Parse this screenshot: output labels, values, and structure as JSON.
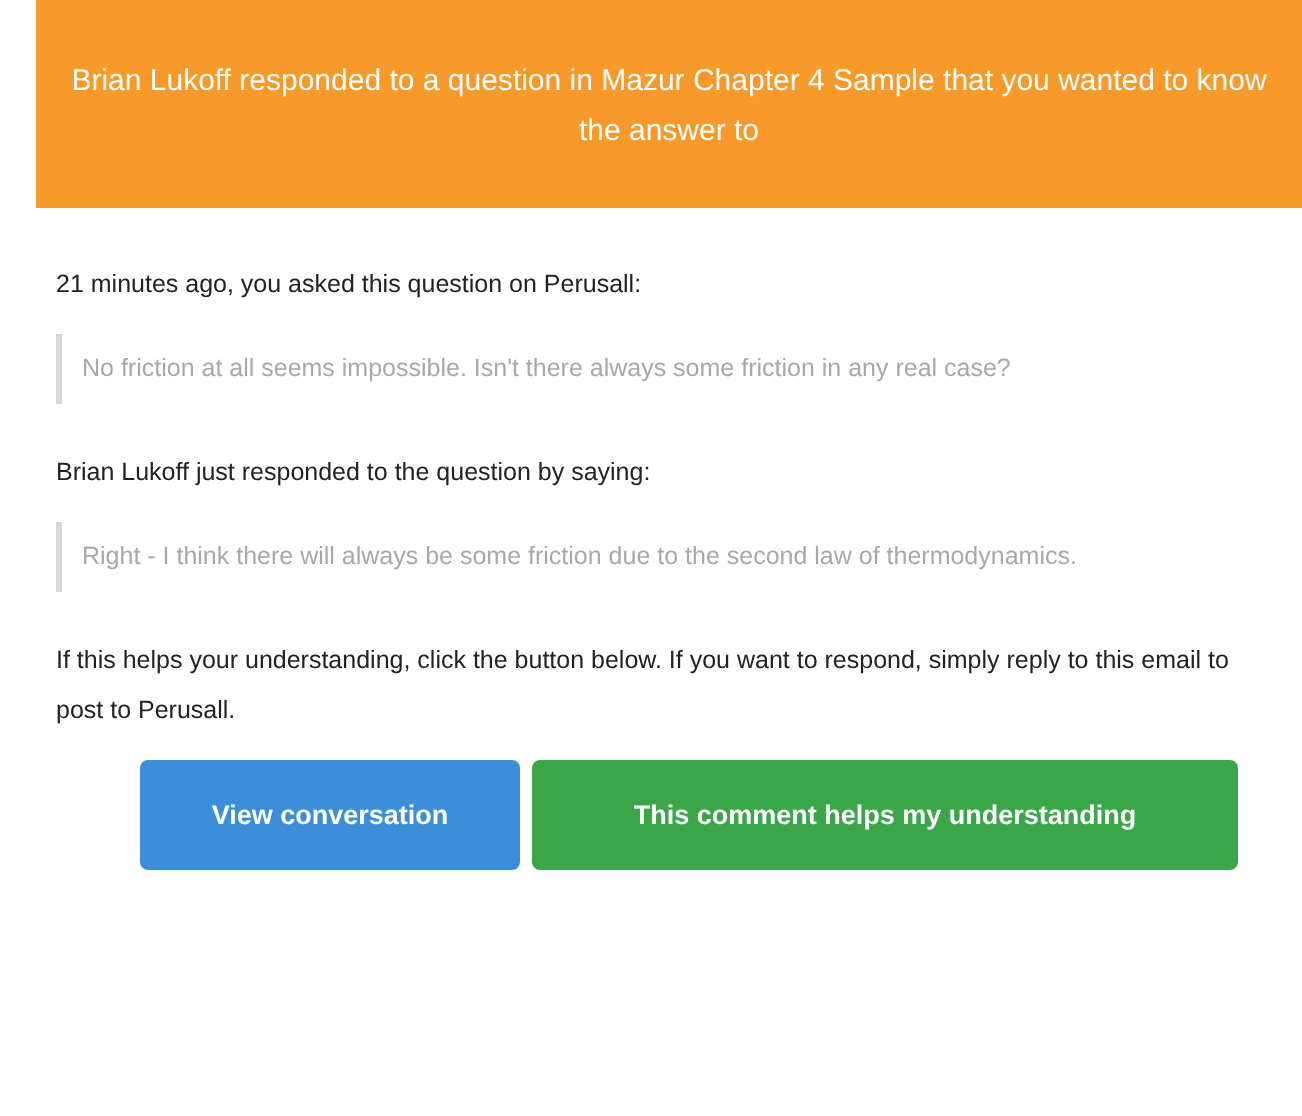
{
  "header": {
    "text": "Brian Lukoff responded to a question in Mazur Chapter 4 Sample that you wanted to know the answer to"
  },
  "blocks": [
    {
      "kind": "paragraph",
      "text": "21 minutes ago,  you asked this question on Perusall:"
    },
    {
      "kind": "quote",
      "text": "No friction at all seems impossible. Isn't there always some friction in any real case?"
    },
    {
      "kind": "paragraph",
      "text": "Brian Lukoff just responded to the question by saying:"
    },
    {
      "kind": "quote",
      "text": "Right - I think there will always be some friction due to the second law of thermodynamics."
    },
    {
      "kind": "paragraph",
      "text": "If this helps your understanding, click the button below. If you want to respond, simply reply to this email to post to Perusall."
    }
  ],
  "buttons": [
    {
      "label": "View conversation",
      "color": "#3d8ed8"
    },
    {
      "label": "This comment helps my understanding",
      "color": "#3aa648"
    }
  ]
}
